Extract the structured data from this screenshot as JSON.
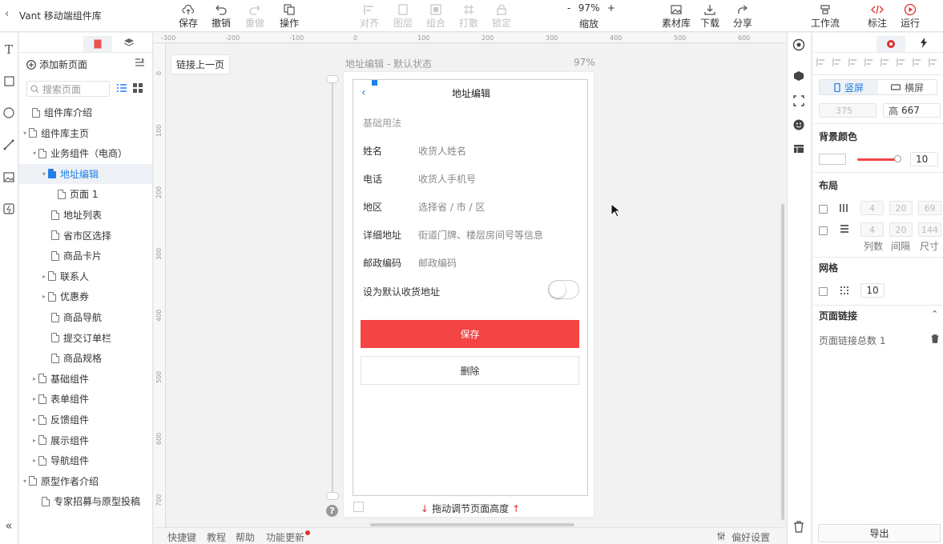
{
  "app": {
    "back_icon": "chevron-left-icon",
    "title": "Vant 移动端组件库"
  },
  "toolbar": {
    "save": "保存",
    "undo": "撤销",
    "redo": "重做",
    "actions": "操作",
    "align": "对齐",
    "layer": "图层",
    "group": "组合",
    "ungroup": "打散",
    "lock": "锁定",
    "zoom_value": "97%",
    "zoom_minus": "-",
    "zoom_plus": "+",
    "zoom_label": "缩放",
    "assets": "素材库",
    "download": "下载",
    "share": "分享",
    "workflow": "工作流",
    "annotate": "标注",
    "run": "运行"
  },
  "left_panel": {
    "tabs": [
      "pages-tab",
      "layers-tab"
    ],
    "add_page": "添加新页面",
    "search_placeholder": "搜索页面",
    "tree": [
      {
        "label": "组件库介绍",
        "indent": 0,
        "caret": ""
      },
      {
        "label": "组件库主页",
        "indent": 0,
        "caret": "▾"
      },
      {
        "label": "业务组件（电商）",
        "indent": 1,
        "caret": "▾"
      },
      {
        "label": "地址编辑",
        "indent": 2,
        "caret": "▾",
        "selected": true
      },
      {
        "label": "页面 1",
        "indent": 3,
        "caret": ""
      },
      {
        "label": "地址列表",
        "indent": 2,
        "caret": ""
      },
      {
        "label": "省市区选择",
        "indent": 2,
        "caret": ""
      },
      {
        "label": "商品卡片",
        "indent": 2,
        "caret": ""
      },
      {
        "label": "联系人",
        "indent": 2,
        "caret": "▸"
      },
      {
        "label": "优惠券",
        "indent": 2,
        "caret": "▸"
      },
      {
        "label": "商品导航",
        "indent": 2,
        "caret": ""
      },
      {
        "label": "提交订单栏",
        "indent": 2,
        "caret": ""
      },
      {
        "label": "商品规格",
        "indent": 2,
        "caret": ""
      },
      {
        "label": "基础组件",
        "indent": 1,
        "caret": "▸"
      },
      {
        "label": "表单组件",
        "indent": 1,
        "caret": "▸"
      },
      {
        "label": "反馈组件",
        "indent": 1,
        "caret": "▸"
      },
      {
        "label": "展示组件",
        "indent": 1,
        "caret": "▸"
      },
      {
        "label": "导航组件",
        "indent": 1,
        "caret": "▸"
      },
      {
        "label": "原型作者介绍",
        "indent": 0,
        "caret": "▾"
      },
      {
        "label": "专家招募与原型投稿",
        "indent": 1,
        "caret": ""
      }
    ],
    "collapse_icon": "double-chevron-left-icon"
  },
  "canvas": {
    "link_prev": "链接上一页",
    "page_state": "地址编辑 - 默认状态",
    "zoom": "97%",
    "ruler_h": [
      "-300",
      "-200",
      "-100",
      "0",
      "100",
      "200",
      "300",
      "400",
      "500",
      "600"
    ],
    "ruler_v": [
      "0",
      "100",
      "200",
      "300",
      "400",
      "500",
      "600",
      "700"
    ],
    "drag_hint": "拖动调节页面高度"
  },
  "phone": {
    "nav_title": "地址编辑",
    "section": "基础用法",
    "fields": [
      {
        "label": "姓名",
        "placeholder": "收货人姓名"
      },
      {
        "label": "电话",
        "placeholder": "收货人手机号"
      },
      {
        "label": "地区",
        "placeholder": "选择省 / 市 / 区"
      },
      {
        "label": "详细地址",
        "placeholder": "街道门牌、楼层房间号等信息"
      },
      {
        "label": "邮政编码",
        "placeholder": "邮政编码"
      }
    ],
    "default_label": "设为默认收货地址",
    "save_btn": "保存",
    "delete_btn": "删除",
    "accent": "#f44444"
  },
  "bottom_bar": {
    "shortcuts": "快捷键",
    "tutorial": "教程",
    "help": "帮助",
    "updates": "功能更新",
    "preferences": "偏好设置"
  },
  "right_panel": {
    "portrait": "竖屏",
    "landscape": "横屏",
    "width": "375",
    "height_label": "高",
    "height": "667",
    "bg_color": "背景颜色",
    "opacity": "10",
    "layout": "布局",
    "layout_cols": [
      "4",
      "20",
      "69"
    ],
    "layout_rows": [
      "4",
      "20",
      "144"
    ],
    "layout_labels": [
      "列数",
      "间隔",
      "尺寸"
    ],
    "grid": "网格",
    "grid_size": "10",
    "page_link": "页面链接",
    "page_link_count": "页面链接总数 1",
    "export": "导出",
    "accent": "#1f80e8"
  }
}
